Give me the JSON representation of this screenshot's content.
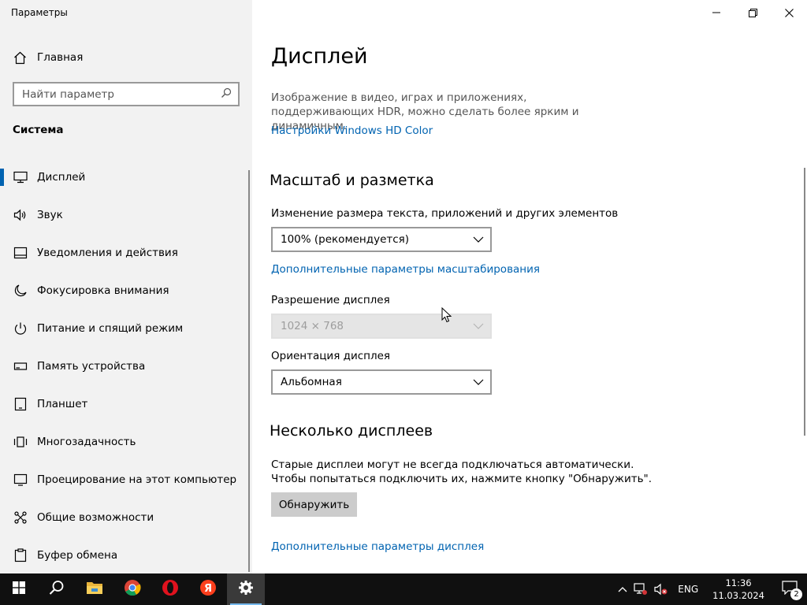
{
  "window": {
    "title": "Параметры",
    "minimize_label": "—",
    "maximize_label": "❐",
    "close_label": "✕"
  },
  "sidebar": {
    "home_label": "Главная",
    "search_placeholder": "Найти параметр",
    "section_title": "Система",
    "items": [
      {
        "label": "Дисплей",
        "icon": "monitor-icon",
        "active": true
      },
      {
        "label": "Звук",
        "icon": "speaker-icon"
      },
      {
        "label": "Уведомления и действия",
        "icon": "notification-icon"
      },
      {
        "label": "Фокусировка внимания",
        "icon": "moon-icon"
      },
      {
        "label": "Питание и спящий режим",
        "icon": "power-icon"
      },
      {
        "label": "Память устройства",
        "icon": "storage-icon"
      },
      {
        "label": "Планшет",
        "icon": "tablet-icon"
      },
      {
        "label": "Многозадачность",
        "icon": "multitask-icon"
      },
      {
        "label": "Проецирование на этот компьютер",
        "icon": "project-icon"
      },
      {
        "label": "Общие возможности",
        "icon": "shared-icon"
      },
      {
        "label": "Буфер обмена",
        "icon": "clipboard-icon"
      }
    ]
  },
  "main": {
    "title": "Дисплей",
    "description": "Изображение в видео, играх и приложениях, поддерживающих HDR, можно сделать более ярким и динамичным.",
    "hd_color_link": "Настройки Windows HD Color",
    "scale_section": "Масштаб и разметка",
    "scale_label": "Изменение размера текста, приложений и других элементов",
    "scale_value": "100% (рекомендуется)",
    "advanced_scale_link": "Дополнительные параметры масштабирования",
    "resolution_label": "Разрешение дисплея",
    "resolution_value": "1024 × 768",
    "orientation_label": "Ориентация дисплея",
    "orientation_value": "Альбомная",
    "multi_section": "Несколько дисплеев",
    "multi_desc_line1": "Старые дисплеи могут не всегда подключаться автоматически.",
    "multi_desc_line2": "Чтобы попытаться подключить их, нажмите кнопку \"Обнаружить\".",
    "detect_button": "Обнаружить",
    "advanced_display_link": "Дополнительные параметры дисплея"
  },
  "taskbar": {
    "apps": [
      "start-icon",
      "search-icon",
      "file-explorer-icon",
      "chrome-icon",
      "opera-icon",
      "yandex-icon",
      "settings-icon"
    ],
    "language": "ENG",
    "time": "11:36",
    "date": "11.03.2024",
    "notification_count": "2"
  },
  "colors": {
    "accent": "#0063b1",
    "sidebar_bg": "#f2f2f2",
    "taskbar_bg": "#101010"
  }
}
